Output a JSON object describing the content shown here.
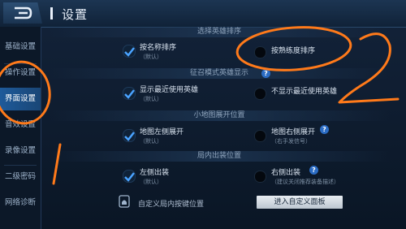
{
  "header": {
    "title": "设置"
  },
  "sidebar": {
    "items": [
      {
        "label": "基础设置"
      },
      {
        "label": "操作设置"
      },
      {
        "label": "界面设置"
      },
      {
        "label": "音效设置"
      },
      {
        "label": "录像设置"
      },
      {
        "label": "二级密码"
      },
      {
        "label": "网络诊断"
      }
    ]
  },
  "sections": [
    {
      "title": "选择英雄排序",
      "left": {
        "label": "按名称排序",
        "sub": "（默认）"
      },
      "right": {
        "label": "按熟练度排序"
      }
    },
    {
      "title": "征召模式英雄显示",
      "left": {
        "label": "显示最近使用英雄",
        "sub": "（默认）"
      },
      "right": {
        "label": "不显示最近使用英雄"
      }
    },
    {
      "title": "小地图展开位置",
      "left": {
        "label": "地图左侧展开",
        "sub": "（默认）"
      },
      "right": {
        "label": "地图右侧展开",
        "sub": "（右手发信号）"
      }
    },
    {
      "title": "局内出装位置",
      "left": {
        "label": "左侧出装",
        "sub": "（默认）"
      },
      "right": {
        "label": "右侧出装",
        "sub": "（建议关闭推荐装备描述）"
      }
    }
  ],
  "custom": {
    "label": "自定义局内按键位置",
    "button": "进入自定义面板"
  },
  "help_glyph": "?",
  "annotations": {
    "mark_left": "1",
    "mark_right": "2"
  },
  "colors": {
    "accent": "#1e5a9a",
    "annotation": "#ff7a1a",
    "check": "#4aa3ff"
  }
}
